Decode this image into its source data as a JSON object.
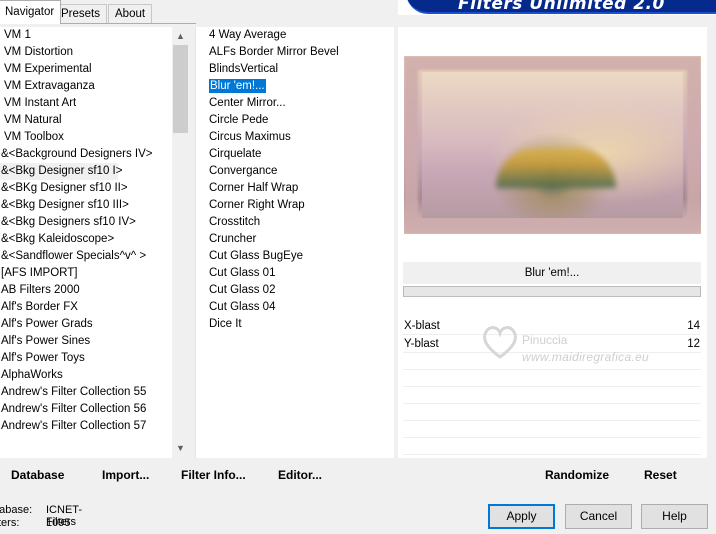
{
  "tabs": [
    "Navigator",
    "Presets",
    "About"
  ],
  "banner": {
    "title": "Filters Unlimited 2.0"
  },
  "categories": [
    "VM 1",
    "VM Distortion",
    "VM Experimental",
    "VM Extravaganza",
    "VM Instant Art",
    "VM Natural",
    "VM Toolbox",
    "&<Background Designers IV>",
    "&<Bkg Designer sf10 I>",
    "&<BKg Designer sf10 II>",
    "&<Bkg Designer sf10 III>",
    "&<Bkg Designers sf10 IV>",
    "&<Bkg Kaleidoscope>",
    "&<Sandflower Specials^v^ >",
    "[AFS IMPORT]",
    "AB Filters 2000",
    "Alf's Border FX",
    "Alf's Power Grads",
    "Alf's Power Sines",
    "Alf's Power Toys",
    "AlphaWorks",
    "Andrew's Filter Collection 55",
    "Andrew's Filter Collection 56",
    "Andrew's Filter Collection 57"
  ],
  "filters": [
    "4 Way Average",
    "ALFs Border Mirror Bevel",
    "BlindsVertical",
    "Blur 'em!...",
    "Center Mirror...",
    "Circle Pede",
    "Circus Maximus",
    "Cirquelate",
    "Convergance",
    "Corner Half Wrap",
    "Corner Right Wrap",
    "Crosstitch",
    "Cruncher",
    "Cut Glass  BugEye",
    "Cut Glass 01",
    "Cut Glass 02",
    "Cut Glass 04",
    "Dice It"
  ],
  "selected_filter": "Blur 'em!...",
  "selected_filter_name": "Blur 'em!...",
  "params": [
    {
      "name": "X-blast",
      "value": "14"
    },
    {
      "name": "Y-blast",
      "value": "12"
    }
  ],
  "watermark": {
    "name": "Pinuccia",
    "url": "www.maidiregrafica.eu"
  },
  "actions": {
    "database": "Database",
    "import": "Import...",
    "filter_info": "Filter Info...",
    "editor": "Editor...",
    "randomize": "Randomize",
    "reset": "Reset"
  },
  "info": {
    "database_label": "atabase:",
    "database_value": "ICNET-Filters",
    "filters_label": "ters:",
    "filters_value": "1095"
  },
  "buttons": {
    "apply": "Apply",
    "cancel": "Cancel",
    "help": "Help"
  },
  "colors": {
    "selection": "#0078d7",
    "banner": "#062a8c"
  }
}
